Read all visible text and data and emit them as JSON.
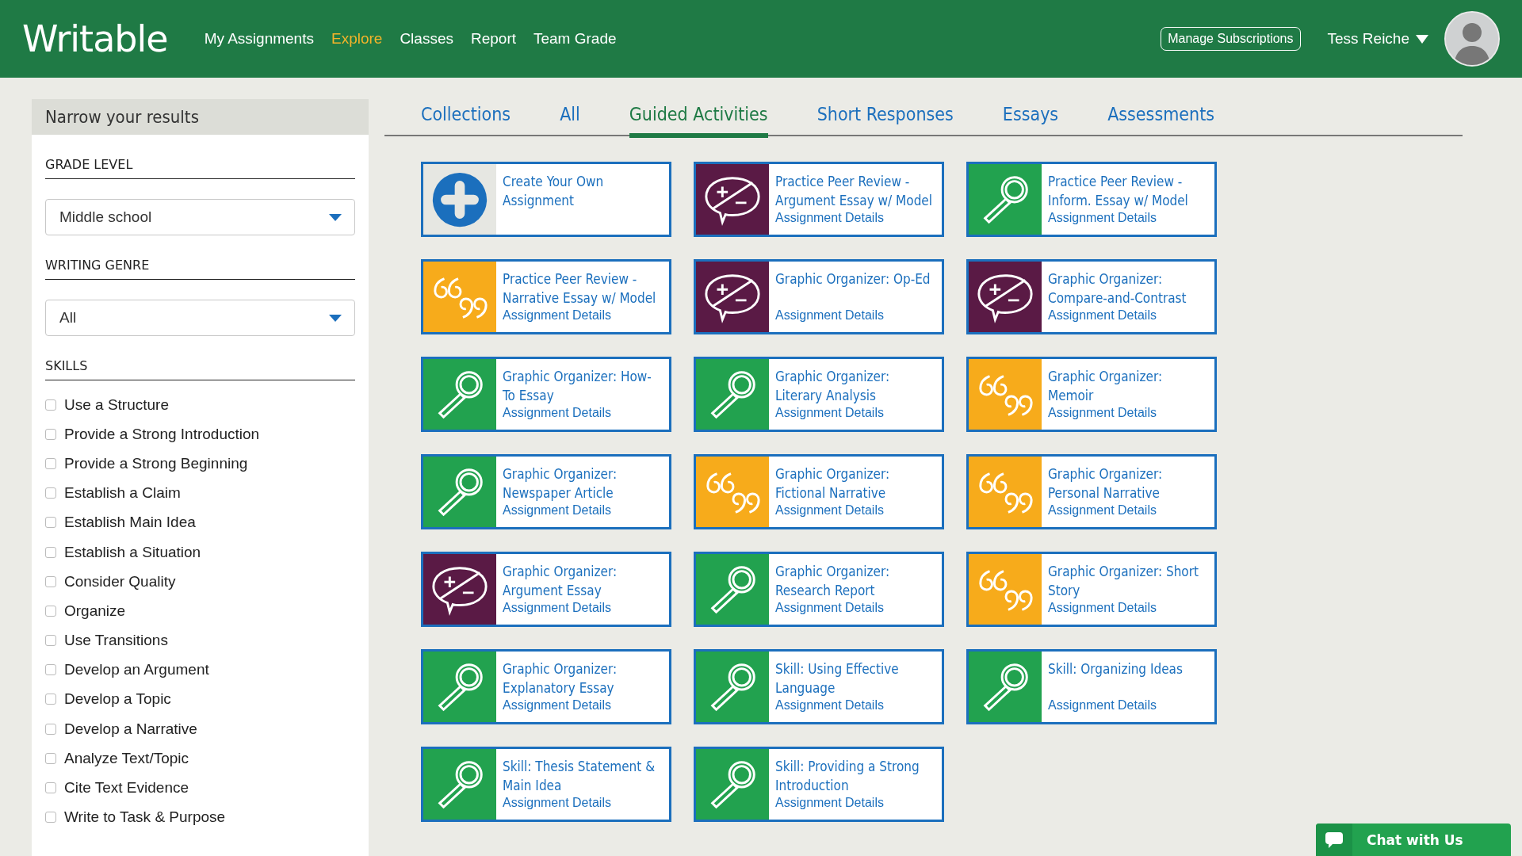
{
  "header": {
    "logo": "Writable",
    "nav": [
      {
        "label": "My Assignments",
        "selected": false
      },
      {
        "label": "Explore",
        "selected": true
      },
      {
        "label": "Classes",
        "selected": false
      },
      {
        "label": "Report",
        "selected": false
      },
      {
        "label": "Team Grade",
        "selected": false
      }
    ],
    "manage_button": "Manage Subscriptions",
    "user": "Tess Reiche"
  },
  "sidebar": {
    "title": "Narrow your results",
    "grade_level": {
      "label": "GRADE LEVEL",
      "value": "Middle school"
    },
    "writing_genre": {
      "label": "WRITING GENRE",
      "value": "All"
    },
    "skills": {
      "label": "SKILLS",
      "items": [
        {
          "label": "Use a Structure",
          "checked": false
        },
        {
          "label": "Provide a Strong Introduction",
          "checked": false
        },
        {
          "label": "Provide a Strong Beginning",
          "checked": false
        },
        {
          "label": "Establish a Claim",
          "checked": false
        },
        {
          "label": "Establish Main Idea",
          "checked": false
        },
        {
          "label": "Establish a Situation",
          "checked": false
        },
        {
          "label": "Consider Quality",
          "checked": false
        },
        {
          "label": "Organize",
          "checked": false
        },
        {
          "label": "Use Transitions",
          "checked": false
        },
        {
          "label": "Develop an Argument",
          "checked": false
        },
        {
          "label": "Develop a Topic",
          "checked": false
        },
        {
          "label": "Develop a Narrative",
          "checked": false
        },
        {
          "label": "Analyze Text/Topic",
          "checked": false
        },
        {
          "label": "Cite Text Evidence",
          "checked": false
        },
        {
          "label": "Write to Task & Purpose",
          "checked": false
        }
      ]
    }
  },
  "tabs": [
    {
      "label": "Collections",
      "selected": false
    },
    {
      "label": "All",
      "selected": false
    },
    {
      "label": "Guided Activities",
      "selected": true
    },
    {
      "label": "Short Responses",
      "selected": false
    },
    {
      "label": "Essays",
      "selected": false
    },
    {
      "label": "Assessments",
      "selected": false
    }
  ],
  "cards": [
    {
      "kind": "create",
      "title": "Create Your Own Assignment"
    },
    {
      "kind": "debate",
      "title": "Practice Peer Review - Argument Essay w/ Model",
      "details": "Assignment Details"
    },
    {
      "kind": "search",
      "title": "Practice Peer Review - Inform. Essay w/ Model",
      "details": "Assignment Details"
    },
    {
      "kind": "quote",
      "title": "Practice Peer Review - Narrative Essay w/ Model",
      "details": "Assignment Details"
    },
    {
      "kind": "debate",
      "title": "Graphic Organizer: Op-Ed",
      "details": "Assignment Details"
    },
    {
      "kind": "debate",
      "title": "Graphic Organizer: Compare-and-Contrast",
      "details": "Assignment Details"
    },
    {
      "kind": "search",
      "title": "Graphic Organizer: How-To Essay",
      "details": "Assignment Details"
    },
    {
      "kind": "search",
      "title": "Graphic Organizer: Literary Analysis",
      "details": "Assignment Details"
    },
    {
      "kind": "quote",
      "title": "Graphic Organizer: Memoir",
      "details": "Assignment Details"
    },
    {
      "kind": "search",
      "title": "Graphic Organizer: Newspaper Article",
      "details": "Assignment Details"
    },
    {
      "kind": "quote",
      "title": "Graphic Organizer: Fictional Narrative",
      "details": "Assignment Details"
    },
    {
      "kind": "quote",
      "title": "Graphic Organizer: Personal Narrative",
      "details": "Assignment Details"
    },
    {
      "kind": "debate",
      "title": "Graphic Organizer: Argument Essay",
      "details": "Assignment Details"
    },
    {
      "kind": "search",
      "title": "Graphic Organizer: Research Report",
      "details": "Assignment Details"
    },
    {
      "kind": "quote",
      "title": "Graphic Organizer: Short Story",
      "details": "Assignment Details"
    },
    {
      "kind": "search",
      "title": "Graphic Organizer: Explanatory Essay",
      "details": "Assignment Details"
    },
    {
      "kind": "search",
      "title": "Skill: Using Effective Language",
      "details": "Assignment Details"
    },
    {
      "kind": "search",
      "title": "Skill: Organizing Ideas",
      "details": "Assignment Details"
    },
    {
      "kind": "search",
      "title": "Skill: Thesis Statement & Main Idea",
      "details": "Assignment Details"
    },
    {
      "kind": "search",
      "title": "Skill: Providing a Strong Introduction",
      "details": "Assignment Details"
    }
  ],
  "chat_button": "Chat with Us"
}
